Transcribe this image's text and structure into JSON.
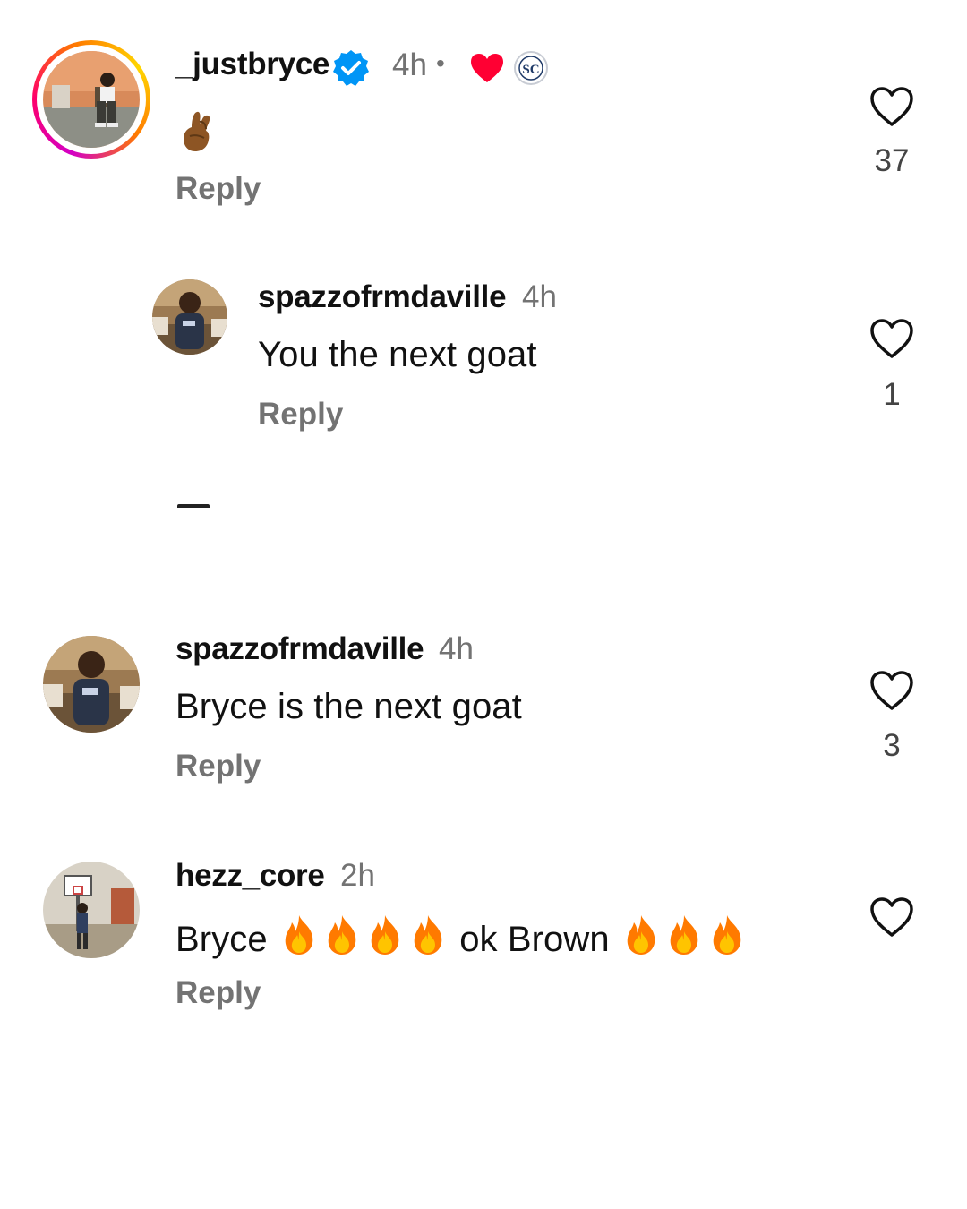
{
  "comments": [
    {
      "username": "_justbryce",
      "verified": true,
      "time": "4h",
      "separator": "•",
      "text": "",
      "reply_label": "Reply",
      "likes": "37",
      "liked_by_creator": true,
      "reaction_icons": [
        "heart-filled-icon",
        "sc-logo-icon"
      ],
      "emoji": "crossed-fingers-icon"
    },
    {
      "username": "spazzofrmdaville",
      "time": "4h",
      "text": "You the next goat",
      "reply_label": "Reply",
      "likes": "1",
      "is_reply": true
    },
    {
      "username": "spazzofrmdaville",
      "time": "4h",
      "text": "Bryce is the next goat",
      "reply_label": "Reply",
      "likes": "3"
    },
    {
      "username": "hezz_core",
      "time": "2h",
      "text_part1": "Bryce",
      "text_part2": "ok Brown",
      "fire_count_1": 4,
      "fire_count_2": 3,
      "reply_label": "Reply",
      "likes": ""
    }
  ],
  "colors": {
    "text": "#111111",
    "muted": "#737373",
    "verified": "#0095f6",
    "heart": "#ff0033"
  }
}
